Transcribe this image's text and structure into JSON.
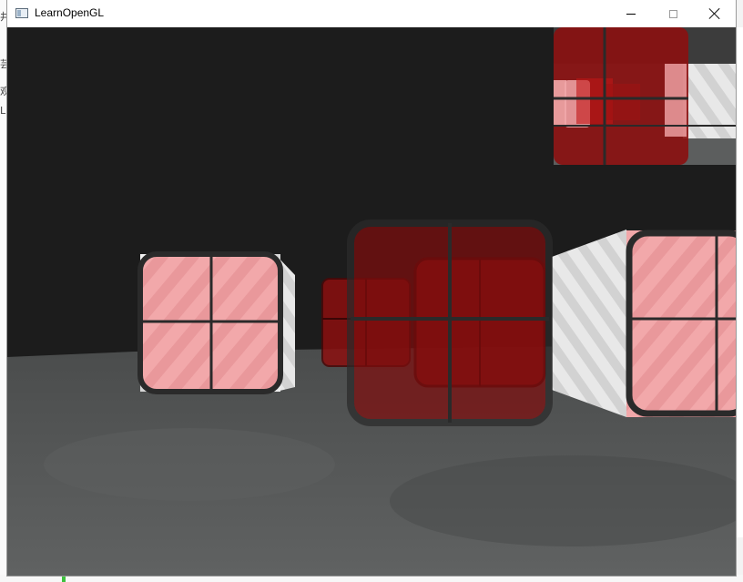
{
  "window": {
    "title": "LearnOpenGL",
    "controls": {
      "minimize": "minimize",
      "maximize": "maximize",
      "close": "close"
    }
  },
  "background_ide": {
    "left_glyphs": [
      "井",
      "芸",
      "观",
      "L"
    ]
  },
  "scene": {
    "clear_color": "#1c1c1c",
    "floor_color": "#4e5050",
    "red_window_color": "#8b0f0f",
    "marble_color": "#e6e6e6",
    "pink_window_color": "#f2a9aa",
    "frame_color": "#2a2a2a"
  }
}
